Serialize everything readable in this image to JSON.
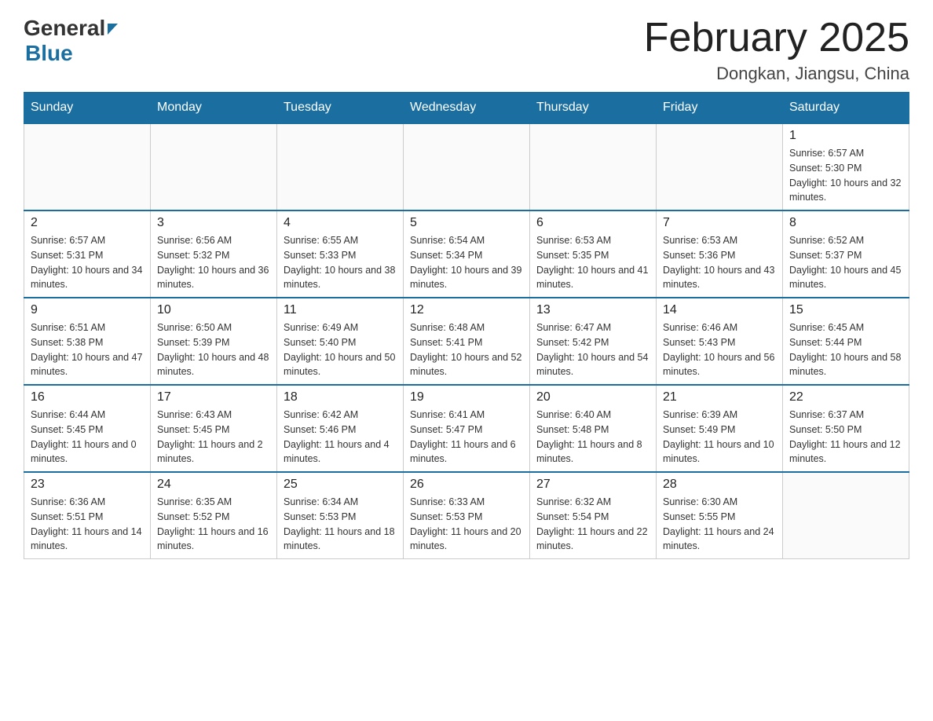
{
  "logo": {
    "general": "General",
    "blue": "Blue"
  },
  "title": "February 2025",
  "location": "Dongkan, Jiangsu, China",
  "days_of_week": [
    "Sunday",
    "Monday",
    "Tuesday",
    "Wednesday",
    "Thursday",
    "Friday",
    "Saturday"
  ],
  "weeks": [
    [
      null,
      null,
      null,
      null,
      null,
      null,
      {
        "day": "1",
        "sunrise": "6:57 AM",
        "sunset": "5:30 PM",
        "daylight": "10 hours and 32 minutes."
      }
    ],
    [
      {
        "day": "2",
        "sunrise": "6:57 AM",
        "sunset": "5:31 PM",
        "daylight": "10 hours and 34 minutes."
      },
      {
        "day": "3",
        "sunrise": "6:56 AM",
        "sunset": "5:32 PM",
        "daylight": "10 hours and 36 minutes."
      },
      {
        "day": "4",
        "sunrise": "6:55 AM",
        "sunset": "5:33 PM",
        "daylight": "10 hours and 38 minutes."
      },
      {
        "day": "5",
        "sunrise": "6:54 AM",
        "sunset": "5:34 PM",
        "daylight": "10 hours and 39 minutes."
      },
      {
        "day": "6",
        "sunrise": "6:53 AM",
        "sunset": "5:35 PM",
        "daylight": "10 hours and 41 minutes."
      },
      {
        "day": "7",
        "sunrise": "6:53 AM",
        "sunset": "5:36 PM",
        "daylight": "10 hours and 43 minutes."
      },
      {
        "day": "8",
        "sunrise": "6:52 AM",
        "sunset": "5:37 PM",
        "daylight": "10 hours and 45 minutes."
      }
    ],
    [
      {
        "day": "9",
        "sunrise": "6:51 AM",
        "sunset": "5:38 PM",
        "daylight": "10 hours and 47 minutes."
      },
      {
        "day": "10",
        "sunrise": "6:50 AM",
        "sunset": "5:39 PM",
        "daylight": "10 hours and 48 minutes."
      },
      {
        "day": "11",
        "sunrise": "6:49 AM",
        "sunset": "5:40 PM",
        "daylight": "10 hours and 50 minutes."
      },
      {
        "day": "12",
        "sunrise": "6:48 AM",
        "sunset": "5:41 PM",
        "daylight": "10 hours and 52 minutes."
      },
      {
        "day": "13",
        "sunrise": "6:47 AM",
        "sunset": "5:42 PM",
        "daylight": "10 hours and 54 minutes."
      },
      {
        "day": "14",
        "sunrise": "6:46 AM",
        "sunset": "5:43 PM",
        "daylight": "10 hours and 56 minutes."
      },
      {
        "day": "15",
        "sunrise": "6:45 AM",
        "sunset": "5:44 PM",
        "daylight": "10 hours and 58 minutes."
      }
    ],
    [
      {
        "day": "16",
        "sunrise": "6:44 AM",
        "sunset": "5:45 PM",
        "daylight": "11 hours and 0 minutes."
      },
      {
        "day": "17",
        "sunrise": "6:43 AM",
        "sunset": "5:45 PM",
        "daylight": "11 hours and 2 minutes."
      },
      {
        "day": "18",
        "sunrise": "6:42 AM",
        "sunset": "5:46 PM",
        "daylight": "11 hours and 4 minutes."
      },
      {
        "day": "19",
        "sunrise": "6:41 AM",
        "sunset": "5:47 PM",
        "daylight": "11 hours and 6 minutes."
      },
      {
        "day": "20",
        "sunrise": "6:40 AM",
        "sunset": "5:48 PM",
        "daylight": "11 hours and 8 minutes."
      },
      {
        "day": "21",
        "sunrise": "6:39 AM",
        "sunset": "5:49 PM",
        "daylight": "11 hours and 10 minutes."
      },
      {
        "day": "22",
        "sunrise": "6:37 AM",
        "sunset": "5:50 PM",
        "daylight": "11 hours and 12 minutes."
      }
    ],
    [
      {
        "day": "23",
        "sunrise": "6:36 AM",
        "sunset": "5:51 PM",
        "daylight": "11 hours and 14 minutes."
      },
      {
        "day": "24",
        "sunrise": "6:35 AM",
        "sunset": "5:52 PM",
        "daylight": "11 hours and 16 minutes."
      },
      {
        "day": "25",
        "sunrise": "6:34 AM",
        "sunset": "5:53 PM",
        "daylight": "11 hours and 18 minutes."
      },
      {
        "day": "26",
        "sunrise": "6:33 AM",
        "sunset": "5:53 PM",
        "daylight": "11 hours and 20 minutes."
      },
      {
        "day": "27",
        "sunrise": "6:32 AM",
        "sunset": "5:54 PM",
        "daylight": "11 hours and 22 minutes."
      },
      {
        "day": "28",
        "sunrise": "6:30 AM",
        "sunset": "5:55 PM",
        "daylight": "11 hours and 24 minutes."
      },
      null
    ]
  ]
}
